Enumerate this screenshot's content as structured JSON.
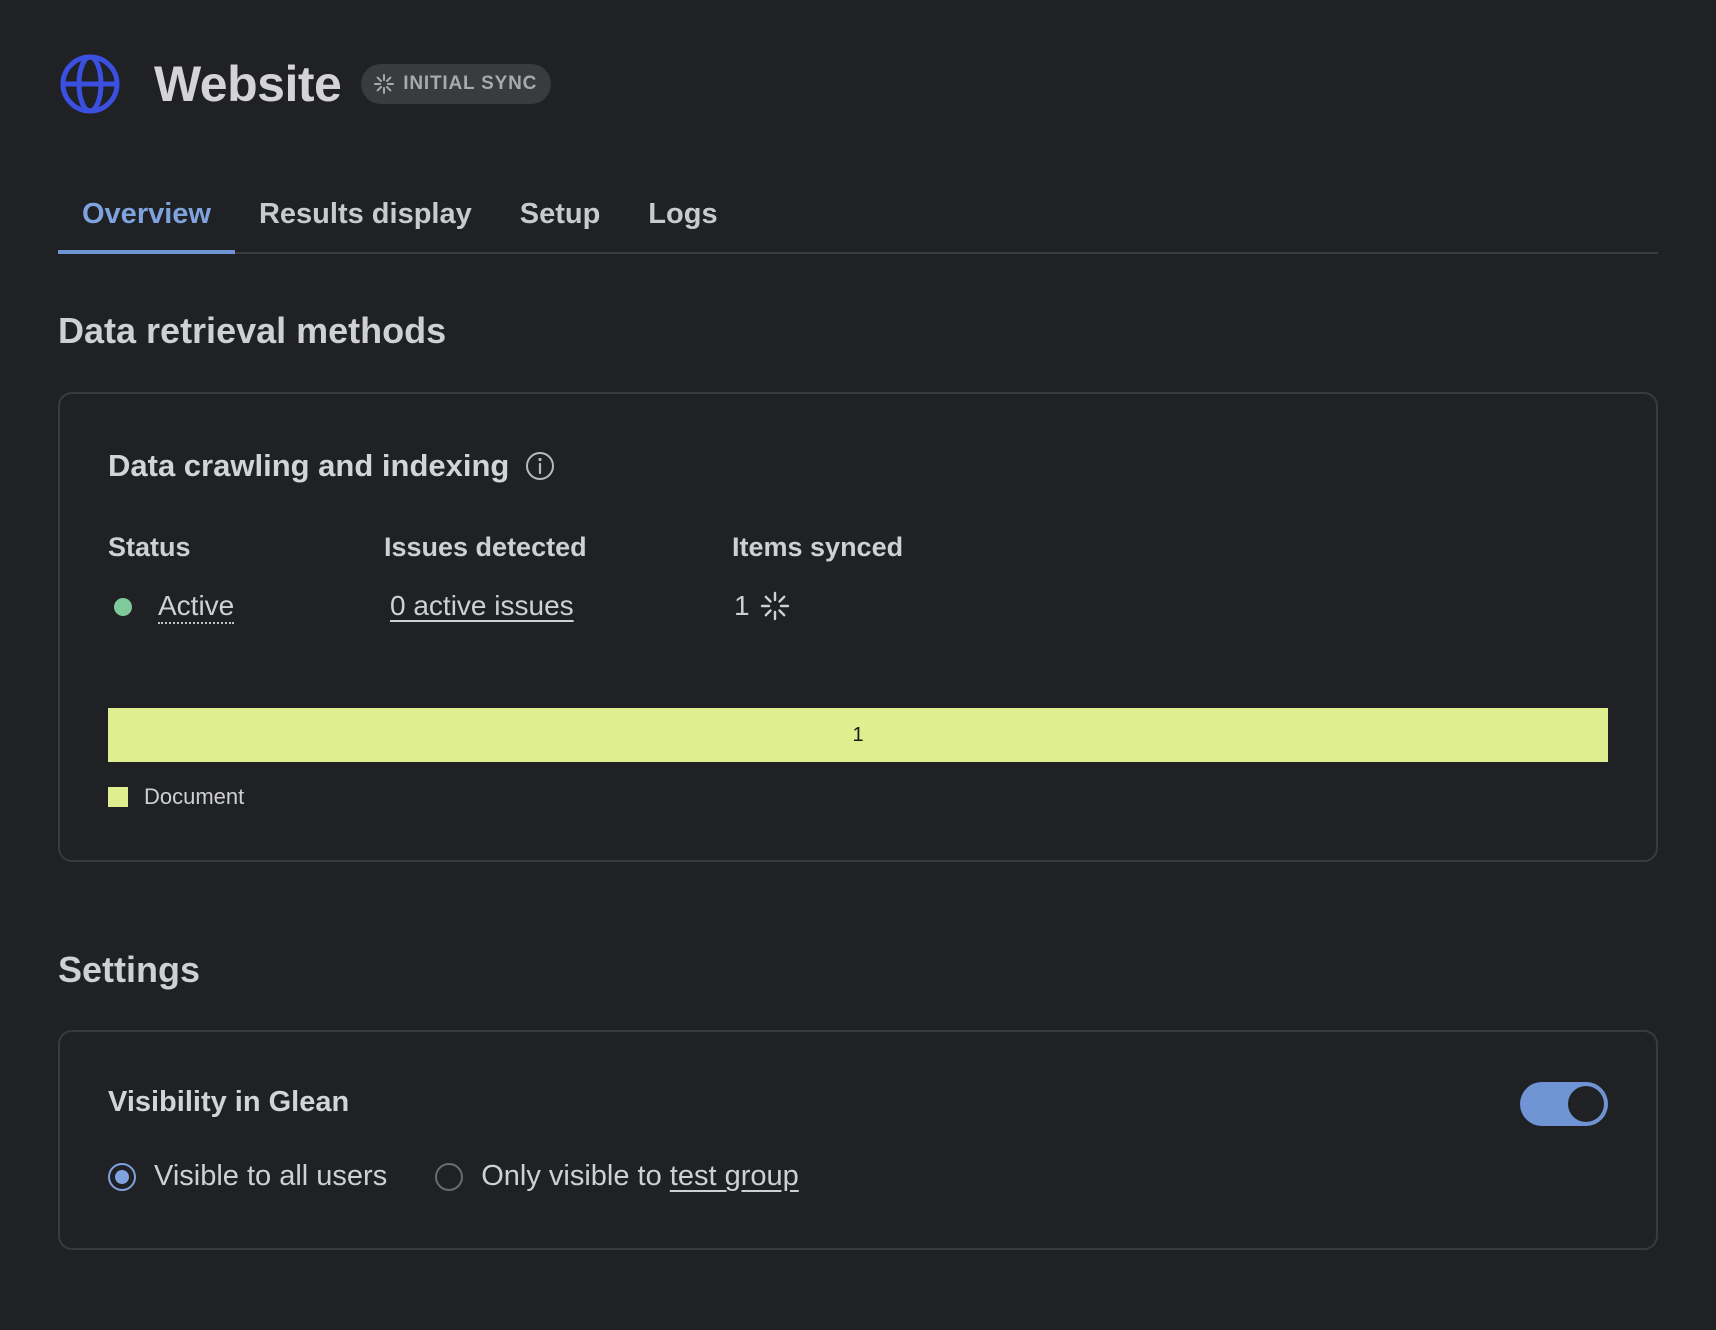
{
  "header": {
    "title": "Website",
    "icon": "globe-icon",
    "badge": {
      "label": "INITIAL SYNC",
      "icon": "loading-spinner-icon"
    }
  },
  "tabs": [
    {
      "label": "Overview",
      "active": true
    },
    {
      "label": "Results display",
      "active": false
    },
    {
      "label": "Setup",
      "active": false
    },
    {
      "label": "Logs",
      "active": false
    }
  ],
  "data_retrieval": {
    "section_title": "Data retrieval methods",
    "card_title": "Data crawling and indexing",
    "info_icon": "info-icon",
    "status": {
      "label": "Status",
      "value": "Active",
      "color": "#7fc99a"
    },
    "issues": {
      "label": "Issues detected",
      "value": "0 active issues"
    },
    "items_synced": {
      "label": "Items synced",
      "value": "1"
    },
    "breakdown": {
      "bar_value": "1",
      "bar_color": "#dfee8f",
      "legend_label": "Document"
    }
  },
  "settings": {
    "section_title": "Settings",
    "visibility_title": "Visibility in Glean",
    "toggle_on": true,
    "options": {
      "all": "Visible to all users",
      "group_prefix": "Only visible to ",
      "group_link": "test group"
    },
    "selected_option": "all"
  },
  "colors": {
    "background": "#202124",
    "accent": "#6f94d4",
    "globe": "#3b4fe0"
  }
}
